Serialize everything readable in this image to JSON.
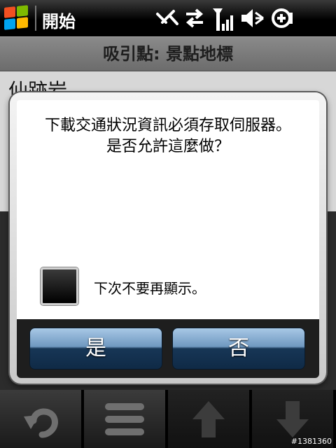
{
  "status_bar": {
    "start_label": "開始",
    "icons": [
      "windows-logo-icon",
      "connectivity-icon",
      "data-transfer-icon",
      "signal-strength-icon",
      "volume-muted-icon",
      "battery-charging-icon"
    ]
  },
  "title_bar": {
    "title": "吸引點: 景點地標"
  },
  "content": {
    "item_title": "仙跡岩"
  },
  "dialog": {
    "message_line1": "下載交通狀況資訊必須存取伺服器。",
    "message_line2": "是否允許這麼做？",
    "checkbox_label": "下次不要再顯示。",
    "checkbox_checked": false,
    "yes_label": "是",
    "no_label": "否"
  },
  "toolbar": {
    "buttons": [
      "back-icon",
      "menu-icon",
      "arrow-up-icon",
      "arrow-down-icon"
    ]
  },
  "watermark": "#1381360",
  "colors": {
    "button_top": "#a8c8e6",
    "button_bottom": "#0f2a46",
    "title_bar": "#7a7a7a"
  }
}
